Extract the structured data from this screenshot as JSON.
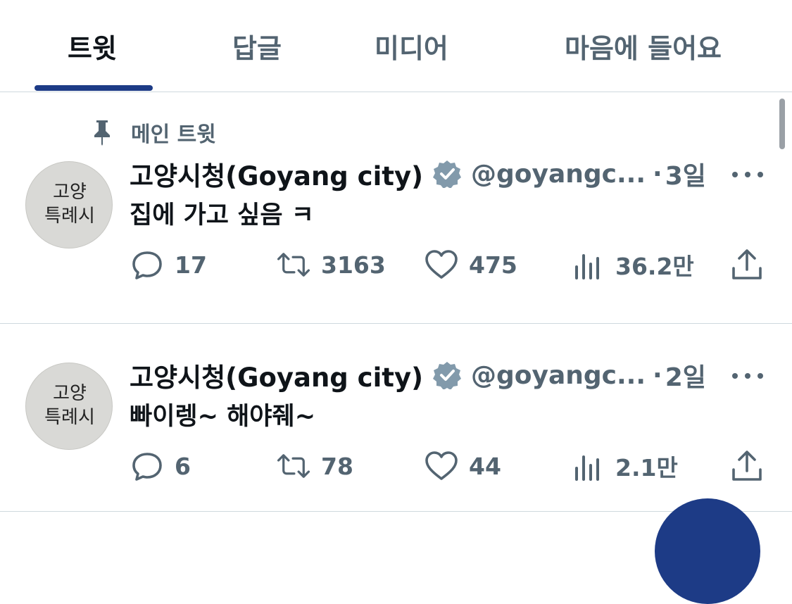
{
  "tabs": [
    {
      "label": "트윗",
      "active": true
    },
    {
      "label": "답글",
      "active": false
    },
    {
      "label": "미디어",
      "active": false
    },
    {
      "label": "마음에 들어요",
      "active": false
    }
  ],
  "colors": {
    "accent": "#1d3b86",
    "muted": "#536471",
    "text": "#0f1419",
    "badge": "#829aab"
  },
  "pinned_label": "메인 트윗",
  "tweets": [
    {
      "name": "고양시청(Goyang city)",
      "handle": "@goyangc...",
      "dot": "·",
      "time": "3일",
      "text": "집에 가고 싶음 ㅋ",
      "avatar_text": [
        "고양",
        "특례시"
      ],
      "replies": "17",
      "retweets": "3163",
      "likes": "475",
      "views": "36.2만"
    },
    {
      "name": "고양시청(Goyang city)",
      "handle": "@goyangc...",
      "dot": "·",
      "time": "2일",
      "text": "빠이렝~ 해야줴~",
      "avatar_text": [
        "고양",
        "특례시"
      ],
      "replies": "6",
      "retweets": "78",
      "likes": "44",
      "views": "2.1만"
    }
  ],
  "icons": [
    "pin-icon",
    "verified-badge-icon",
    "more-icon",
    "reply-icon",
    "retweet-icon",
    "like-icon",
    "views-icon",
    "share-icon"
  ]
}
